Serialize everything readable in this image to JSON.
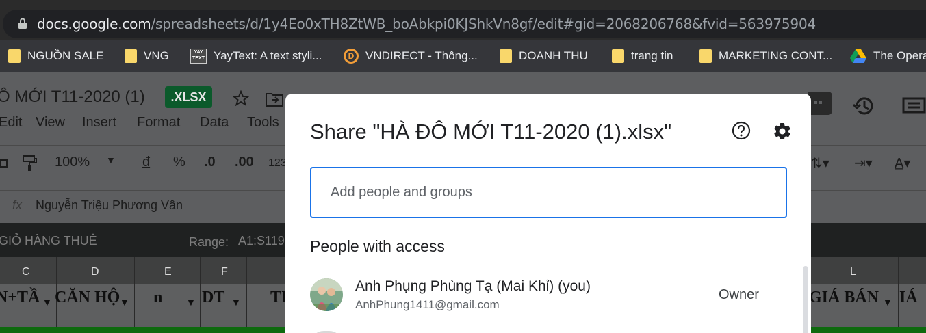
{
  "browser": {
    "url_host": "docs.google.com",
    "url_path": "/spreadsheets/d/1y4Eo0xTH8ZtWB_boAbkpi0KJShkVn8gf/edit#gid=2068206768&fvid=563975904",
    "bookmarks": [
      {
        "label": "NGUỒN SALE",
        "icon": "folder-icon"
      },
      {
        "label": "VNG",
        "icon": "folder-icon"
      },
      {
        "label": "YayText: A text styli...",
        "icon": "yaytext-icon"
      },
      {
        "label": "VNDIRECT - Thông...",
        "icon": "vndirect-icon"
      },
      {
        "label": "DOANH THU",
        "icon": "folder-icon"
      },
      {
        "label": "trang tin",
        "icon": "folder-icon"
      },
      {
        "label": "MARKETING CONT...",
        "icon": "folder-icon"
      },
      {
        "label": "The Opera",
        "icon": "drive-icon"
      }
    ]
  },
  "sheets": {
    "doc_title": "Ô MỚI T11-2020 (1)",
    "badge": ".XLSX",
    "menus": [
      "Edit",
      "View",
      "Insert",
      "Format",
      "Data",
      "Tools"
    ],
    "zoom": "100%",
    "currency": "đ",
    "percent": "%",
    "dec_dec": ".0",
    "dec_inc": ".00",
    "num_fmt": "123",
    "formula_value": "Nguyễn Triệu Phương Vân",
    "fx": "fx",
    "band_left": "GIỎ HÀNG THUÊ",
    "range_label": "Range:",
    "range_value": "A1:S119",
    "columns": [
      "C",
      "D",
      "E",
      "F",
      "L"
    ],
    "cells": [
      "N+TẦ",
      "CĂN HỘ",
      "n",
      "DT",
      "TI",
      "GIÁ BÁN",
      "IÁ"
    ]
  },
  "dialog": {
    "title": "Share \"HÀ ĐÔ MỚI T11-2020 (1).xlsx\"",
    "input_placeholder": "Add people and groups",
    "section_title": "People with access",
    "people": [
      {
        "name": "Anh Phụng Phùng Tạ (Mai Khỉ) (you)",
        "email": "AnhPhung1411@gmail.com",
        "role": "Owner"
      }
    ]
  },
  "colors": {
    "accent": "#1a73e8",
    "sheets_green": "#0b5a2b",
    "overlay": "#5d5e60"
  }
}
